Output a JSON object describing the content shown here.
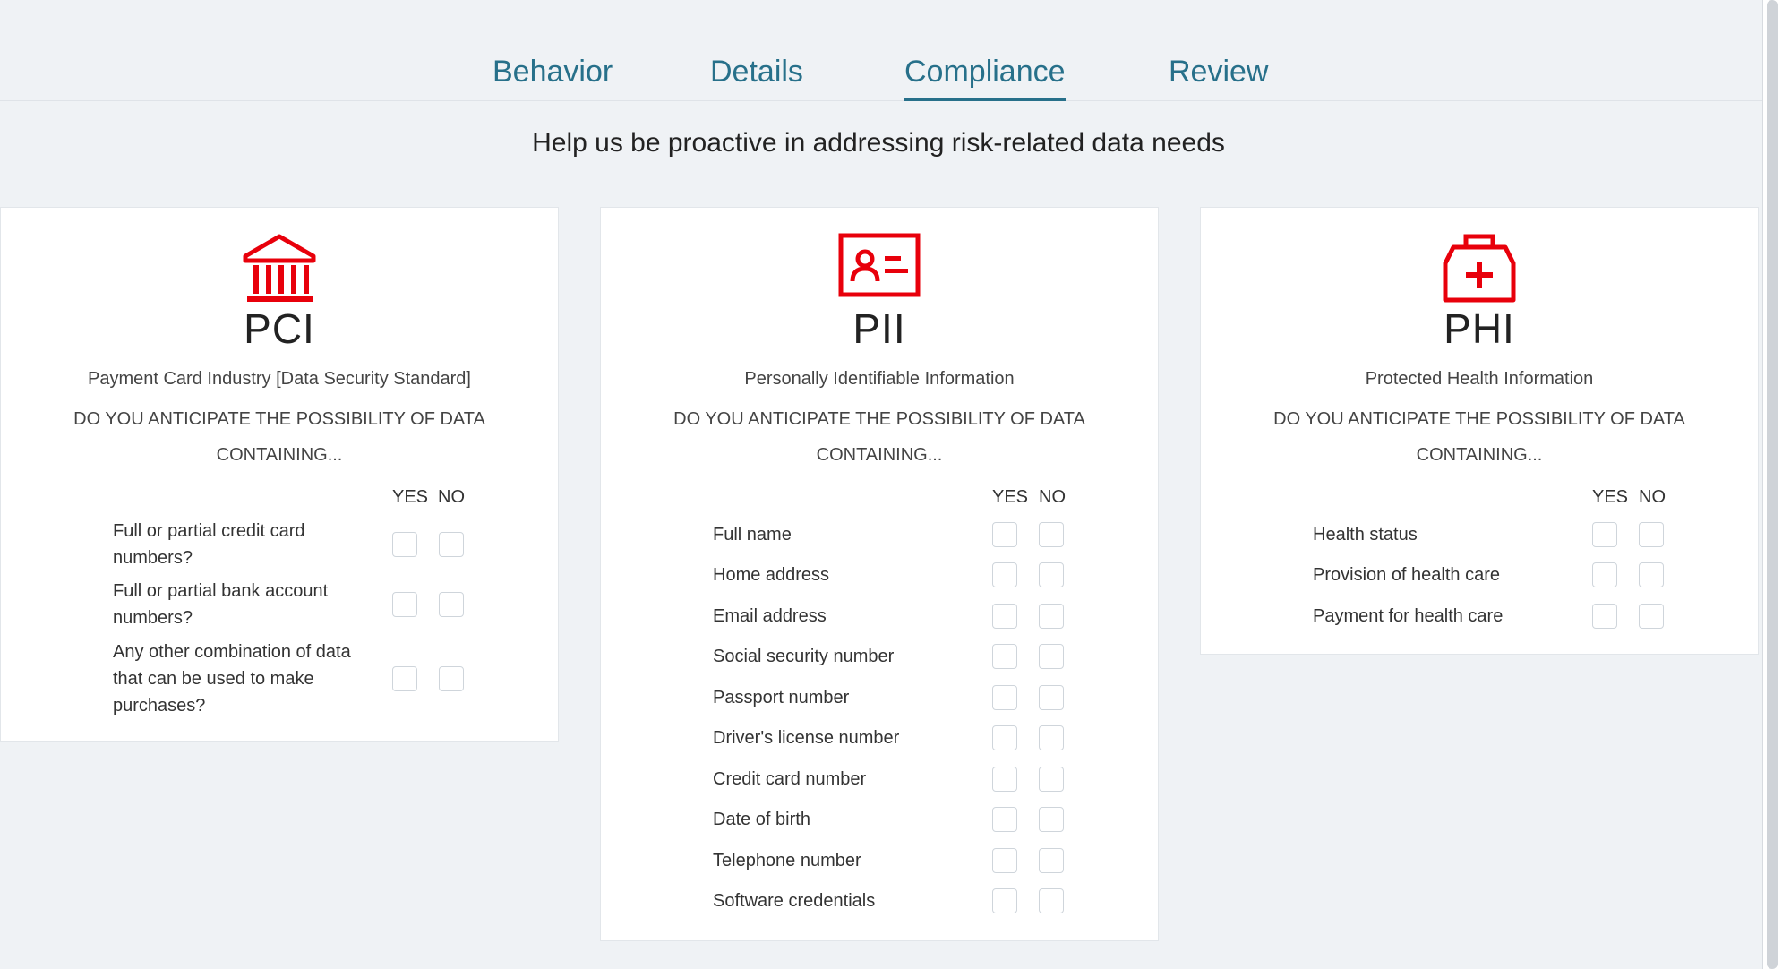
{
  "tabs": [
    "Behavior",
    "Details",
    "Compliance",
    "Review"
  ],
  "active_tab": "Compliance",
  "subtitle": "Help us be proactive in addressing risk-related data needs",
  "accent_color": "#e8000b",
  "tab_color": "#27708a",
  "yes_label": "YES",
  "no_label": "NO",
  "question": "DO YOU ANTICIPATE THE POSSIBILITY OF DATA CONTAINING...",
  "cards": [
    {
      "icon": "bank-icon",
      "abbr": "PCI",
      "full_name": "Payment Card Industry [Data Security Standard]",
      "items": [
        "Full or partial credit card numbers?",
        "Full or partial bank account numbers?",
        "Any other combination of data that can be used to make purchases?"
      ]
    },
    {
      "icon": "id-card-icon",
      "abbr": "PII",
      "full_name": "Personally Identifiable Information",
      "items": [
        "Full name",
        "Home address",
        "Email address",
        "Social security number",
        "Passport number",
        "Driver's license number",
        "Credit card number",
        "Date of birth",
        "Telephone number",
        "Software credentials"
      ]
    },
    {
      "icon": "medical-kit-icon",
      "abbr": "PHI",
      "full_name": "Protected Health Information",
      "items": [
        "Health status",
        "Provision of health care",
        "Payment for health care"
      ]
    }
  ]
}
